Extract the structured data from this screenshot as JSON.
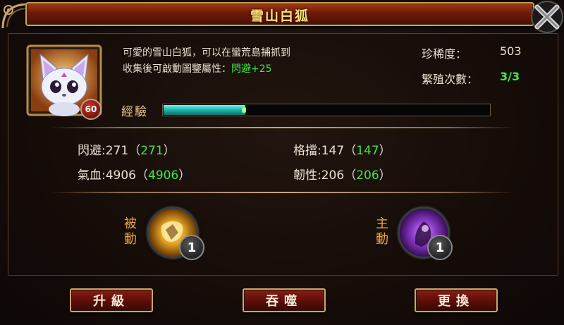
{
  "window": {
    "title": "雪山白狐"
  },
  "pet": {
    "level": "60",
    "desc_line1": "可愛的雪山白狐，可以在蠻荒島捕抓到",
    "desc_line2_prefix": "收集後可啟動圖鑒屬性：",
    "desc_line2_bonus": "閃避+25",
    "rarity_label": "珍稀度：",
    "rarity_value": "503",
    "breed_label": "繁殖次數：",
    "breed_value": "3/3",
    "exp_label": "經驗",
    "exp_progress": 0.25
  },
  "attributes": [
    {
      "name": "閃避",
      "base": "271",
      "total": "271"
    },
    {
      "name": "格擋",
      "base": "147",
      "total": "147"
    },
    {
      "name": "氣血",
      "base": "4906",
      "total": "4906"
    },
    {
      "name": "韌性",
      "base": "206",
      "total": "206"
    }
  ],
  "skills": {
    "passive": {
      "label_1": "被",
      "label_2": "動",
      "count": "1",
      "icon": "passive-skill-icon"
    },
    "active": {
      "label_1": "主",
      "label_2": "動",
      "count": "1",
      "icon": "active-skill-icon"
    }
  },
  "buttons": {
    "upgrade": "升級",
    "devour": "吞噬",
    "replace": "更換"
  },
  "colors": {
    "title_bar": "#7a1e08",
    "title_text": "#ffe27a",
    "green_value": "#3ee84a",
    "exp_bar": "#21b9b1",
    "button": "#5e0f09",
    "frame_gold": "#c9a56c"
  }
}
